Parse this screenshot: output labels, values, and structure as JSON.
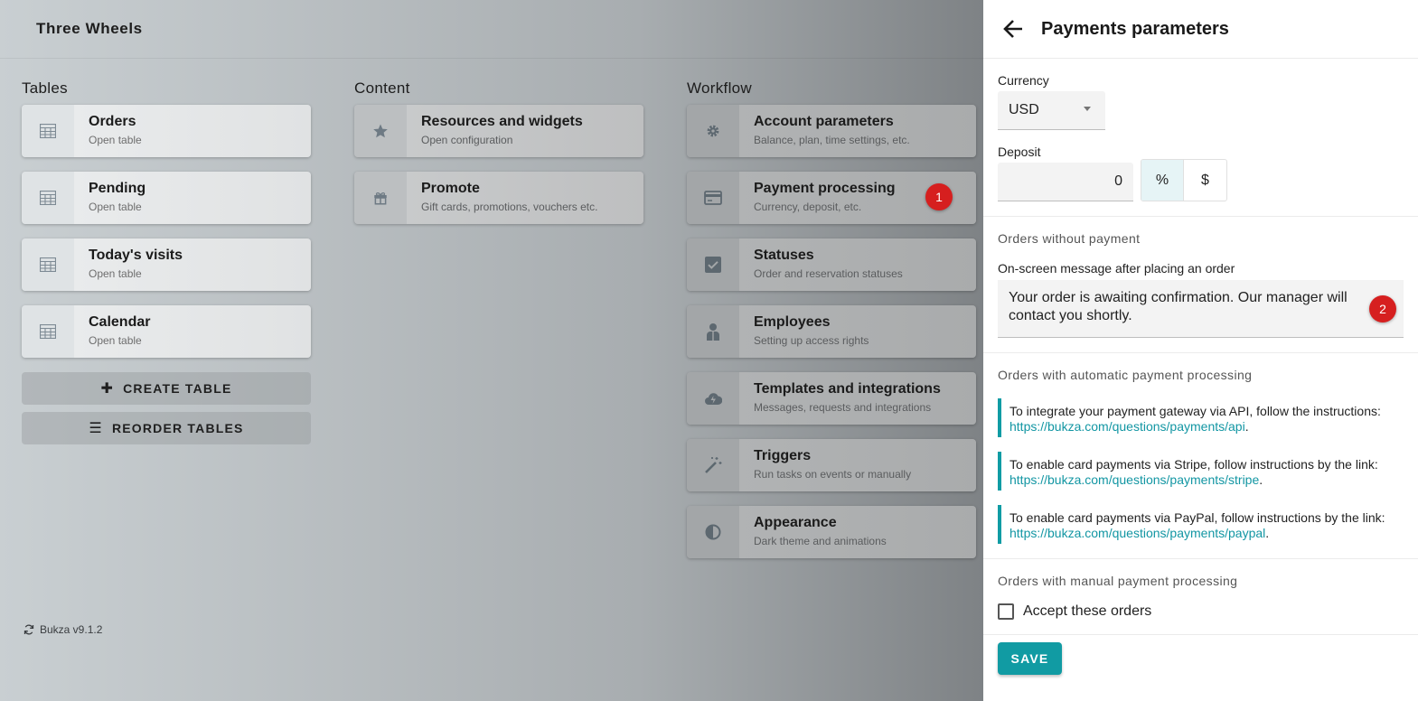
{
  "app": {
    "title": "Three Wheels",
    "version": "Bukza v9.1.2"
  },
  "tables": {
    "title": "Tables",
    "items": [
      {
        "title": "Orders",
        "sub": "Open table"
      },
      {
        "title": "Pending",
        "sub": "Open table"
      },
      {
        "title": "Today's visits",
        "sub": "Open table"
      },
      {
        "title": "Calendar",
        "sub": "Open table"
      }
    ],
    "create_label": "CREATE TABLE",
    "reorder_label": "REORDER TABLES"
  },
  "content": {
    "title": "Content",
    "items": [
      {
        "title": "Resources and widgets",
        "sub": "Open configuration"
      },
      {
        "title": "Promote",
        "sub": "Gift cards, promotions, vouchers etc."
      }
    ]
  },
  "workflow": {
    "title": "Workflow",
    "items": [
      {
        "title": "Account parameters",
        "sub": "Balance, plan, time settings, etc."
      },
      {
        "title": "Payment processing",
        "sub": "Currency, deposit, etc."
      },
      {
        "title": "Statuses",
        "sub": "Order and reservation statuses"
      },
      {
        "title": "Employees",
        "sub": "Setting up access rights"
      },
      {
        "title": "Templates and integrations",
        "sub": "Messages, requests and integrations"
      },
      {
        "title": "Triggers",
        "sub": "Run tasks on events or manually"
      },
      {
        "title": "Appearance",
        "sub": "Dark theme and animations"
      }
    ]
  },
  "badges": {
    "one": "1",
    "two": "2"
  },
  "panel": {
    "title": "Payments parameters",
    "currency_label": "Currency",
    "currency_value": "USD",
    "deposit_label": "Deposit",
    "deposit_value": "0",
    "toggle_percent": "%",
    "toggle_dollar": "$",
    "without_payment_title": "Orders without payment",
    "message_label": "On-screen message after placing an order",
    "message_value": "Your order is awaiting confirmation. Our manager will contact you shortly.",
    "auto_title": "Orders with automatic payment processing",
    "info": [
      {
        "text": "To integrate your payment gateway via API, follow the instructions:",
        "link": "https://bukza.com/questions/payments/api"
      },
      {
        "text": "To enable card payments via Stripe, follow instructions by the link:",
        "link": "https://bukza.com/questions/payments/stripe"
      },
      {
        "text": "To enable card payments via PayPal, follow instructions by the link:",
        "link": "https://bukza.com/questions/payments/paypal"
      }
    ],
    "manual_title": "Orders with manual payment processing",
    "accept_label": "Accept these orders",
    "save_label": "SAVE"
  },
  "colors": {
    "accent": "#119ba3",
    "badge": "#d61f1f",
    "info_border": "#109ca4"
  }
}
